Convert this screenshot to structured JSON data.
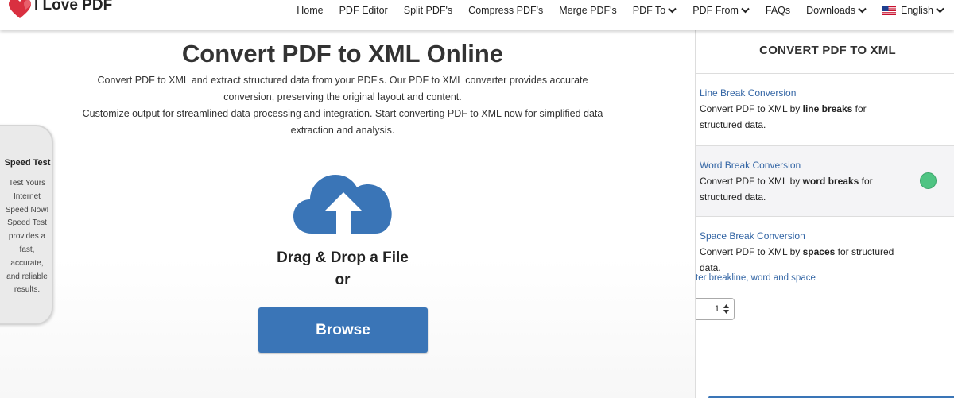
{
  "header": {
    "logo_text": "I Love PDF",
    "nav": [
      {
        "label": "Home",
        "dropdown": false
      },
      {
        "label": "PDF Editor",
        "dropdown": false
      },
      {
        "label": "Split PDF's",
        "dropdown": false
      },
      {
        "label": "Compress PDF's",
        "dropdown": false
      },
      {
        "label": "Merge PDF's",
        "dropdown": false
      },
      {
        "label": "PDF To",
        "dropdown": true
      },
      {
        "label": "PDF From",
        "dropdown": true
      },
      {
        "label": "FAQs",
        "dropdown": false
      },
      {
        "label": "Downloads",
        "dropdown": true
      }
    ],
    "language": "English"
  },
  "main": {
    "title": "Convert PDF to XML Online",
    "description_1": "Convert PDF to XML and extract structured data from your PDF's. Our PDF to XML converter provides accurate conversion, preserving the original layout and content.",
    "description_2": "Customize output for streamlined data processing and integration. Start converting PDF to XML now for simplified data extraction and analysis.",
    "drag_drop": "Drag & Drop a File",
    "or": "or",
    "browse_label": "Browse"
  },
  "speed_test": {
    "title": "Speed Test",
    "text": "Test Yours Internet Speed Now! Speed Test provides a fast, accurate, and reliable results."
  },
  "sidebar": {
    "title": "CONVERT PDF TO XML",
    "options": [
      {
        "label": "Line Break Conversion",
        "desc_pre": "Convert PDF to XML by ",
        "desc_bold": "line breaks",
        "desc_post": " for structured data.",
        "selected": false
      },
      {
        "label": "Word Break Conversion",
        "desc_pre": "Convert PDF to XML by ",
        "desc_bold": "word breaks",
        "desc_post": " for structured data.",
        "selected": true
      },
      {
        "label": "Space Break Conversion",
        "desc_pre": "Convert PDF to XML by ",
        "desc_bold": "spaces",
        "desc_post": " for structured data.",
        "selected": false
      }
    ],
    "hint": "ter breakline, word and space",
    "stepper_value": "1"
  },
  "colors": {
    "accent": "#3a75b7",
    "link": "#3466a5",
    "selected_dot": "#4fc483"
  }
}
